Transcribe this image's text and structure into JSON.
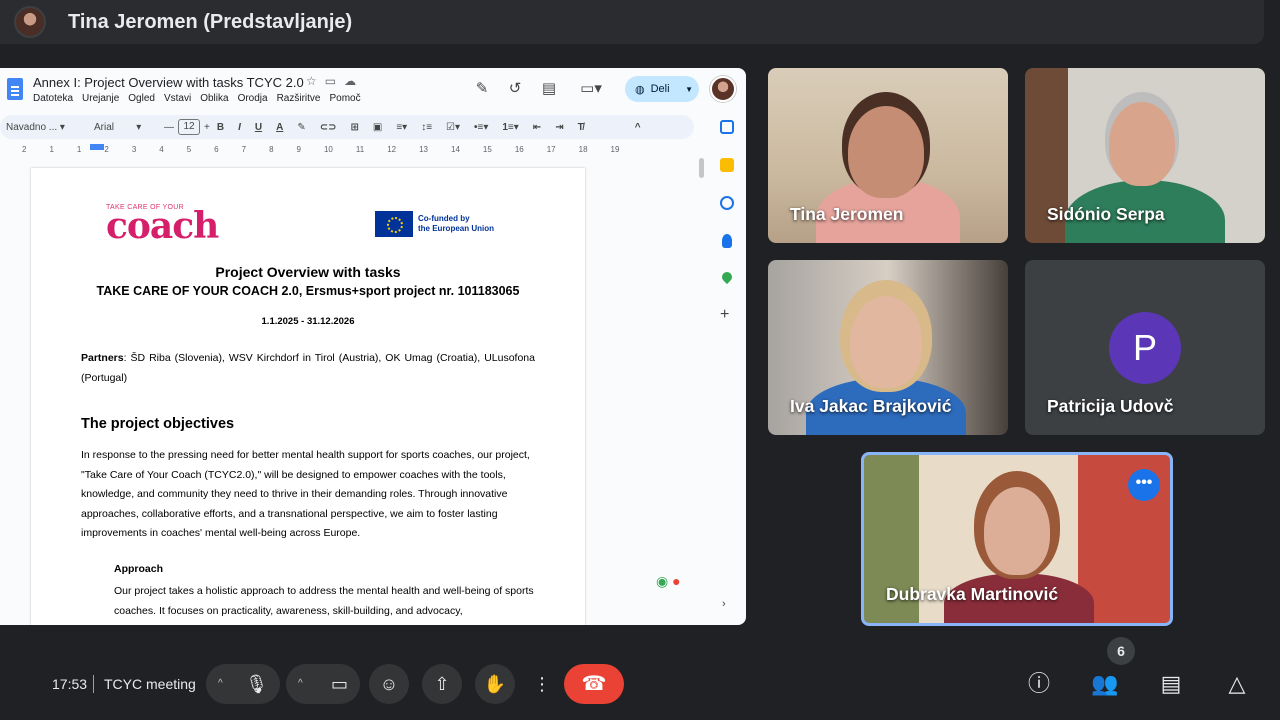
{
  "header": {
    "presenter_title": "Tina Jeromen (Predstavljanje)"
  },
  "doc": {
    "title": "Annex I: Project Overview with tasks  TCYC 2.0",
    "menu": [
      "Datoteka",
      "Urejanje",
      "Ogled",
      "Vstavi",
      "Oblika",
      "Orodja",
      "Razširitve",
      "Pomoč"
    ],
    "share_label": "Deli",
    "toolbar": {
      "style": "Navadno ...",
      "font": "Arial",
      "size": "12"
    },
    "ruler_marks": [
      "2",
      "1",
      "1",
      "2",
      "3",
      "4",
      "5",
      "6",
      "7",
      "8",
      "9",
      "10",
      "11",
      "12",
      "13",
      "14",
      "15",
      "16",
      "17",
      "18",
      "19"
    ],
    "logo_small": "TAKE CARE OF YOUR",
    "logo_big": "coach",
    "eu_line1": "Co-funded by",
    "eu_line2": "the European Union",
    "heading1": "Project Overview with tasks",
    "heading2": "TAKE CARE OF YOUR COACH 2.0, Ersmus+sport project nr. 101183065",
    "dates": "1.1.2025 - 31.12.2026",
    "partners_label": "Partners",
    "partners_text": ": ŠD Riba (Slovenia), WSV Kirchdorf in Tirol (Austria), OK Umag (Croatia), ULusofona (Portugal)",
    "objectives_heading": "The project objectives",
    "objectives_text": "In response to the pressing need for better mental health support for sports coaches, our project, \"Take Care of Your Coach (TCYC2.0),\" will be designed to empower coaches with the tools, knowledge, and community they need to thrive in their demanding roles. Through innovative approaches, collaborative efforts, and a transnational perspective, we aim to foster lasting improvements in coaches' mental well-being across Europe.",
    "approach_heading": "Approach",
    "approach_text": "Our project takes a holistic approach to address the mental health and well-being of sports coaches. It focuses on practicality, awareness, skill-building, and advocacy,"
  },
  "participants": [
    {
      "name": "Tina Jeromen"
    },
    {
      "name": "Sidónio Serpa"
    },
    {
      "name": "Iva Jakac Brajković"
    },
    {
      "name": "Patricija Udovč",
      "initial": "P"
    },
    {
      "name": "Dubravka Martinović"
    }
  ],
  "bottom_bar": {
    "time": "17:53",
    "meeting_name": "TCYC meeting",
    "people_count": "6"
  },
  "icons": {
    "mic": "microphone-icon",
    "camera": "camera-icon",
    "emoji": "emoji-icon",
    "present": "present-screen-icon",
    "hand": "raise-hand-icon",
    "more": "more-vert-icon",
    "end": "end-call-icon",
    "info": "info-icon",
    "people": "people-icon",
    "chat": "chat-icon",
    "activities": "activities-icon"
  },
  "colors": {
    "end_call": "#ea4335",
    "accent": "#1a73e8",
    "avatar_purple": "#5b37b8"
  }
}
